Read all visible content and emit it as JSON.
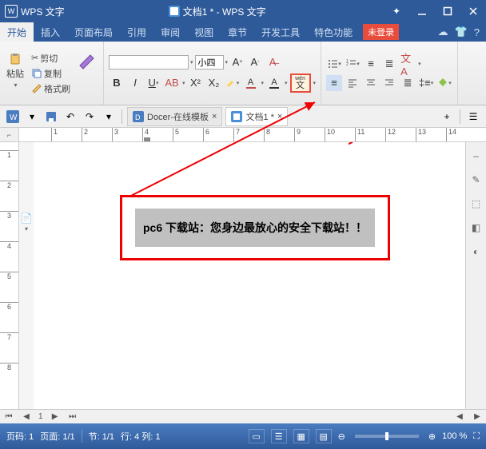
{
  "title": {
    "app": "WPS 文字",
    "doc": "文档1 * - WPS 文字"
  },
  "menu": {
    "items": [
      "开始",
      "插入",
      "页面布局",
      "引用",
      "审阅",
      "视图",
      "章节",
      "开发工具",
      "特色功能"
    ],
    "notlogin": "未登录"
  },
  "ribbon": {
    "paste_label": "粘贴",
    "cut_label": "剪切",
    "copy_label": "复制",
    "brush_label": "格式刷",
    "font_name": "",
    "font_size": "小四",
    "wen_label": "wén",
    "wen_char": "文"
  },
  "tabs": {
    "docer": "Docer-在线模板",
    "active": "文档1 *"
  },
  "ruler": {
    "h": [
      1,
      2,
      3,
      4,
      5,
      6,
      7,
      8,
      9,
      10,
      11,
      12,
      13,
      14
    ],
    "v": [
      1,
      2,
      3,
      4,
      5,
      6,
      7,
      8
    ]
  },
  "document": {
    "content": "pc6 下载站：您身边最放心的安全下载站！！"
  },
  "nav": {
    "page": "1"
  },
  "status": {
    "page": "页码: 1",
    "page_of": "页面: 1/1",
    "section": "节: 1/1",
    "pos": "行: 4  列: 1",
    "zoom": "100 %"
  }
}
